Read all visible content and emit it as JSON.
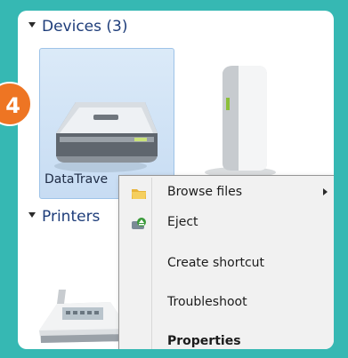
{
  "badge": {
    "number": "4"
  },
  "sections": {
    "devices_header": "Devices (3)",
    "printers_header": "Printers"
  },
  "devices": [
    {
      "label": "DataTrave",
      "icon": "usb-drive-icon",
      "selected": true
    },
    {
      "label": "",
      "icon": "external-hard-drive-icon",
      "selected": false
    }
  ],
  "printer": {
    "icon": "printer-icon"
  },
  "context_menu": {
    "items": [
      {
        "label": "Browse files",
        "icon": "folder-icon",
        "submenu": true,
        "bold": false
      },
      {
        "label": "Eject",
        "icon": "eject-icon",
        "submenu": false,
        "bold": false
      },
      {
        "label": "Create shortcut",
        "icon": "",
        "submenu": false,
        "bold": false
      },
      {
        "label": "Troubleshoot",
        "icon": "",
        "submenu": false,
        "bold": false
      },
      {
        "label": "Properties",
        "icon": "",
        "submenu": false,
        "bold": true
      }
    ]
  },
  "colors": {
    "frame": "#36b8b3",
    "badge": "#ee7523",
    "selection": "#cfe2f7",
    "menu_bg": "#f1f1f1"
  }
}
